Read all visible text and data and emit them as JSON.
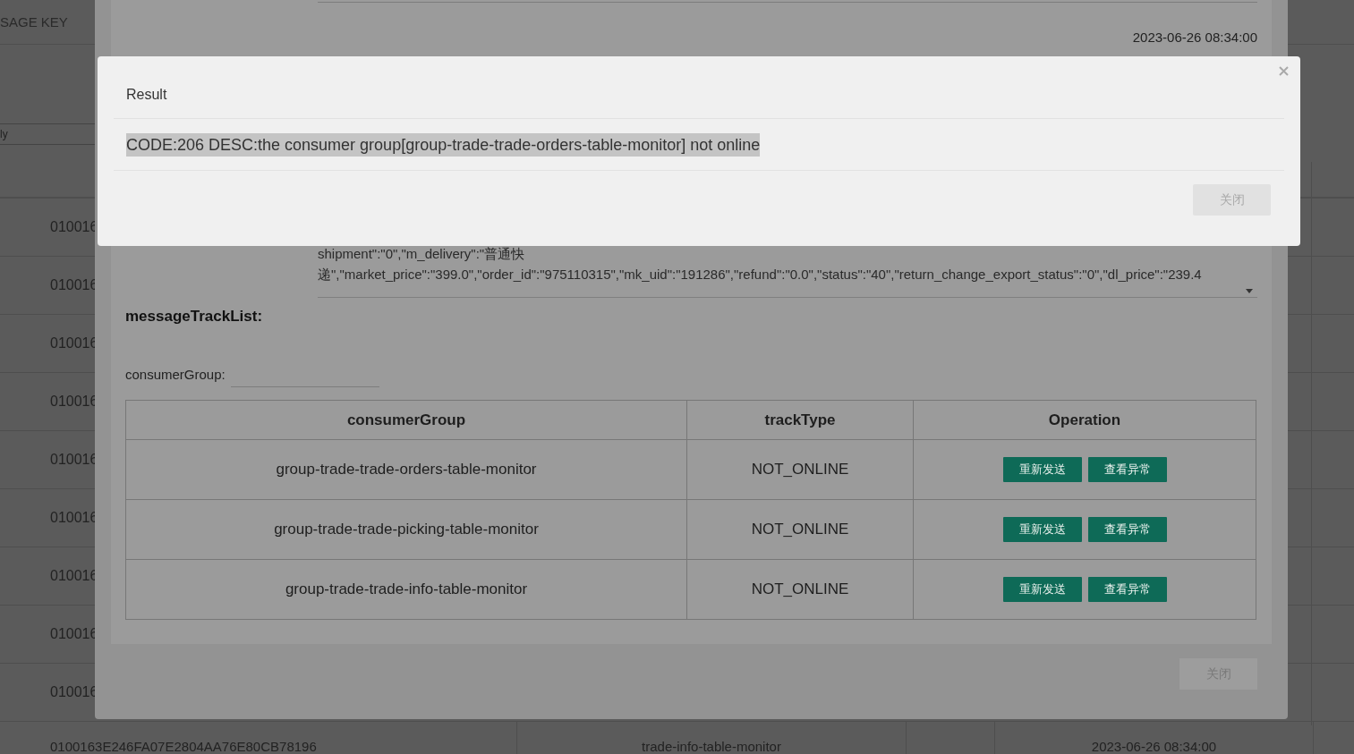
{
  "background_page": {
    "header": "SAGE KEY",
    "filter_text": "ly",
    "rows": [
      {
        "column_1": "010016"
      },
      {
        "column_1": "010016"
      },
      {
        "column_1": "010016"
      },
      {
        "column_1": "010016"
      },
      {
        "column_1": "010016"
      },
      {
        "column_1": "010016"
      },
      {
        "column_1": "010016"
      },
      {
        "column_1": "010016"
      },
      {
        "column_1": "010016"
      }
    ],
    "last_row": {
      "column_1": "0100163E246FA07E2804AA76E80CB78196",
      "column_2": "trade-info-table-monitor",
      "column_4": "2023-06-26 08:34:00"
    }
  },
  "message_dialog": {
    "timestamp": "2023-06-26 08:34:00",
    "message_body_lines": [
      "shipment\":\"0\",\"m_delivery\":\"普通快",
      "递\",\"market_price\":\"399.0\",\"order_id\":\"975110315\",\"mk_uid\":\"191286\",\"refund\":\"0.0\",\"status\":\"40\",\"return_change_export_status\":\"0\",\"dl_price\":\"239.4"
    ],
    "track_section": {
      "title": "messageTrackList:",
      "filter_label": "consumerGroup:",
      "columns": [
        "consumerGroup",
        "trackType",
        "Operation"
      ],
      "rows": [
        {
          "consumer_group": "group-trade-trade-orders-table-monitor",
          "track_type": "NOT_ONLINE",
          "actions": [
            "重新发送",
            "查看异常"
          ]
        },
        {
          "consumer_group": "group-trade-trade-picking-table-monitor",
          "track_type": "NOT_ONLINE",
          "actions": [
            "重新发送",
            "查看异常"
          ]
        },
        {
          "consumer_group": "group-trade-trade-info-table-monitor",
          "track_type": "NOT_ONLINE",
          "actions": [
            "重新发送",
            "查看异常"
          ]
        }
      ]
    },
    "close_button": "关闭"
  },
  "result_dialog": {
    "title": "Result",
    "message": "CODE:206 DESC:the consumer group[group-trade-trade-orders-table-monitor] not online",
    "close_button": "关闭"
  }
}
